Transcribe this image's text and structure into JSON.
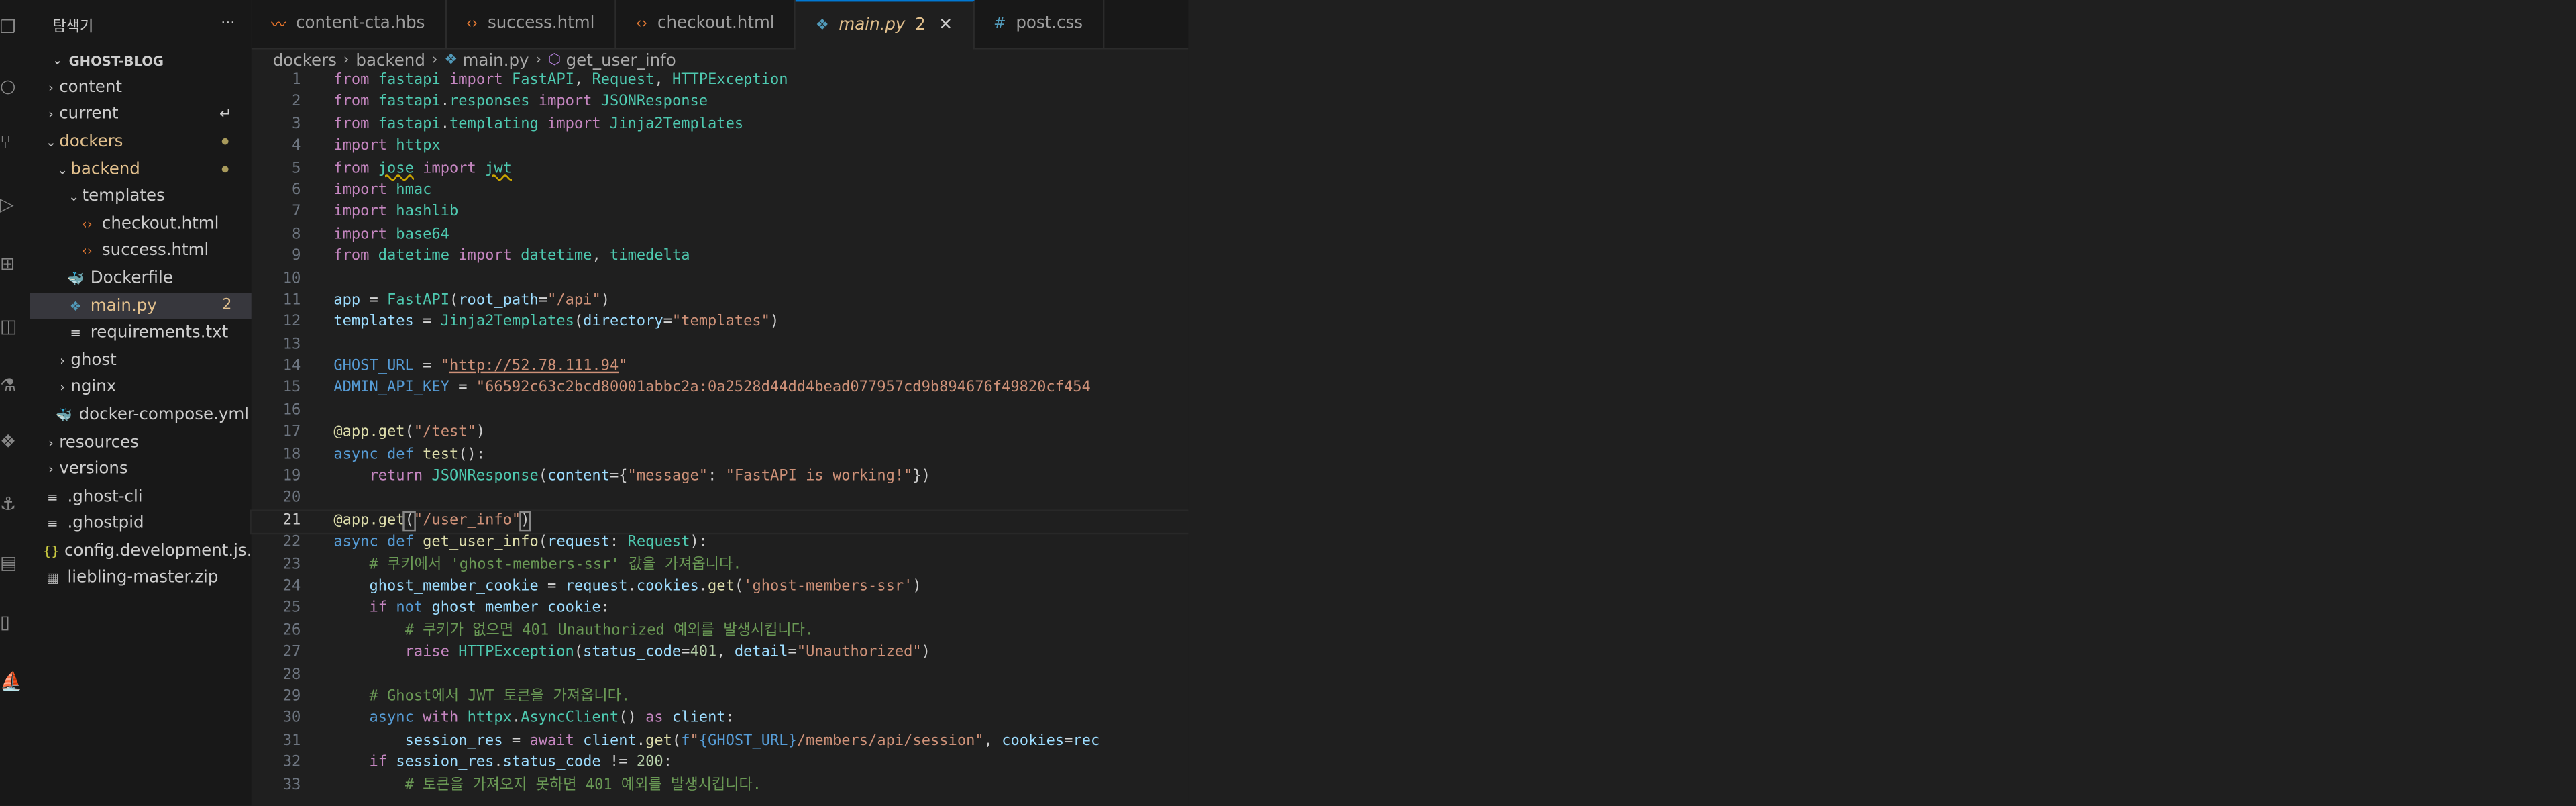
{
  "sidebar": {
    "header_title": "탐색기",
    "more_icon": "ellipsis-icon",
    "root_label": "GHOST-BLOG",
    "items": [
      {
        "label": "content",
        "type": "folder",
        "depth": 0,
        "open": false
      },
      {
        "label": "current",
        "type": "folder",
        "depth": 0,
        "open": false,
        "badge": "↵"
      },
      {
        "label": "dockers",
        "type": "folder",
        "depth": 0,
        "open": true,
        "modified": true
      },
      {
        "label": "backend",
        "type": "folder",
        "depth": 1,
        "open": true,
        "modified": true
      },
      {
        "label": "templates",
        "type": "folder",
        "depth": 2,
        "open": true
      },
      {
        "label": "checkout.html",
        "type": "html",
        "depth": 3
      },
      {
        "label": "success.html",
        "type": "html",
        "depth": 3
      },
      {
        "label": "Dockerfile",
        "type": "docker",
        "depth": 2
      },
      {
        "label": "main.py",
        "type": "python",
        "depth": 2,
        "selected": true,
        "badge": "2"
      },
      {
        "label": "requirements.txt",
        "type": "text",
        "depth": 2
      },
      {
        "label": "ghost",
        "type": "folder",
        "depth": 1,
        "open": false
      },
      {
        "label": "nginx",
        "type": "folder",
        "depth": 1,
        "open": false
      },
      {
        "label": "docker-compose.yml",
        "type": "docker",
        "depth": 1
      },
      {
        "label": "resources",
        "type": "folder",
        "depth": 0,
        "open": false
      },
      {
        "label": "versions",
        "type": "folder",
        "depth": 0,
        "open": false
      },
      {
        "label": ".ghost-cli",
        "type": "text",
        "depth": 0
      },
      {
        "label": ".ghostpid",
        "type": "text",
        "depth": 0
      },
      {
        "label": "config.development.js...",
        "type": "json",
        "depth": 0
      },
      {
        "label": "liebling-master.zip",
        "type": "zip",
        "depth": 0
      }
    ]
  },
  "tabs": [
    {
      "label": "content-cta.hbs",
      "icon": "handlebars-icon",
      "active": false
    },
    {
      "label": "success.html",
      "icon": "html-icon",
      "active": false
    },
    {
      "label": "checkout.html",
      "icon": "html-icon",
      "active": false
    },
    {
      "label": "main.py",
      "icon": "python-icon",
      "active": true,
      "badge": "2",
      "close": "✕"
    },
    {
      "label": "post.css",
      "icon": "css-icon",
      "active": false
    }
  ],
  "breadcrumb": [
    "dockers",
    "backend",
    "main.py",
    "get_user_info"
  ],
  "editor": {
    "current_line": 21
  },
  "colors": {
    "accent": "#0078d4",
    "modified": "#e2c08d",
    "background": "#1f1f1f",
    "sidebar": "#181818"
  }
}
